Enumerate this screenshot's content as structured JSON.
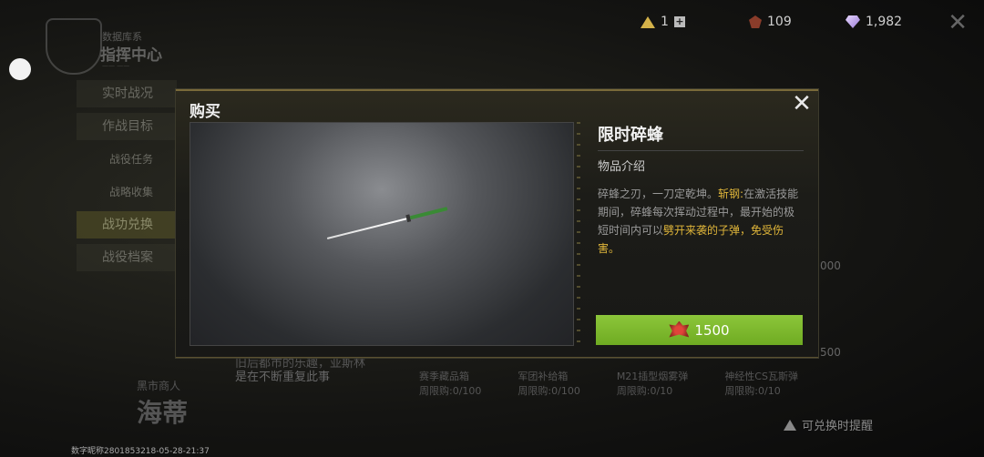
{
  "background": {
    "logo": {
      "line1": "数据库系",
      "line2": "指挥中心",
      "line3": "—— ——"
    },
    "nav": [
      {
        "label": "实时战况",
        "type": "main",
        "active": false
      },
      {
        "label": "作战目标",
        "type": "main",
        "active": false
      },
      {
        "label": "战役任务",
        "type": "sub",
        "active": false
      },
      {
        "label": "战略收集",
        "type": "sub",
        "active": false
      },
      {
        "label": "战功兑换",
        "type": "main",
        "active": true
      },
      {
        "label": "战役档案",
        "type": "main",
        "active": false
      }
    ],
    "currencies": [
      {
        "icon": "triangle-token-icon",
        "value": "1"
      },
      {
        "icon": "merit-badge-icon",
        "value": "109"
      },
      {
        "icon": "diamond-icon",
        "value": "1,982"
      }
    ],
    "merchant_label": "黑市商人",
    "merchant_name": "海蒂",
    "npc_text_1": "旧后都市的乐趣，亚斯林",
    "npc_text_2": "是在不断重复此事",
    "cards": [
      "赛季藏品箱",
      "军团补给箱",
      "M21插型烟雾弹",
      "神经性CS瓦斯弹"
    ],
    "card_limits": [
      "周限购:0/100",
      "周限购:0/100",
      "周限购:0/10",
      "周限购:0/10"
    ],
    "side_price_1": "000",
    "side_price_2": "500",
    "hint": "可兑换时提醒",
    "uid": "数字昵称2801853218-05-28-21:37"
  },
  "modal": {
    "title": "购买",
    "item_name": "限时碎蜂",
    "section_label": "物品介绍",
    "desc_part1": "碎蜂之刃，一刀定乾坤。",
    "desc_skill": "斩钢:",
    "desc_part2": "在激活技能期间，碎蜂每次挥动过程中，最开始的极短时间内可以",
    "desc_highlight": "劈开来袭的子弹，免受伤害",
    "desc_end": "。",
    "price": "1500",
    "price_icon": "merit-badge-icon"
  },
  "colors": {
    "accent_green": "#7ab82c",
    "highlight_yellow": "#e0b63a",
    "modal_border": "#7a6a3a"
  }
}
